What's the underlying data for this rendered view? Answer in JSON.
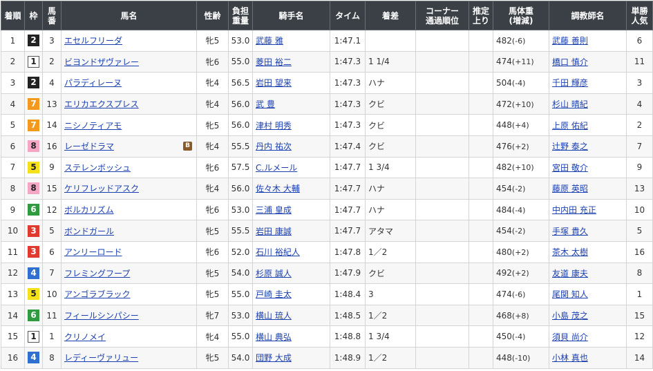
{
  "headers": {
    "rank": "着順",
    "waku": "枠",
    "umaban": [
      "馬",
      "番"
    ],
    "horse": "馬名",
    "sexage": "性齢",
    "weight": [
      "負担",
      "重量"
    ],
    "jockey": "騎手名",
    "time": "タイム",
    "margin": "着差",
    "corner": [
      "コーナー",
      "通過順位"
    ],
    "last": [
      "推定",
      "上り"
    ],
    "body": [
      "馬体重",
      "(増減)"
    ],
    "trainer": "調教師名",
    "pop": [
      "単勝",
      "人気"
    ]
  },
  "rows": [
    {
      "rank": "1",
      "waku": "2",
      "umaban": "3",
      "horse": "エセルフリーダ",
      "blinker": "",
      "sexage": "牝5",
      "weight": "53.0",
      "jockey": "武藤 雅",
      "time": "1:47.1",
      "margin": "",
      "corner": "",
      "last": "",
      "bw": "482",
      "bwd": "(-6)",
      "trainer": "武藤 善則",
      "pop": "6"
    },
    {
      "rank": "2",
      "waku": "1",
      "umaban": "2",
      "horse": "ビヨンドザヴァレー",
      "blinker": "",
      "sexage": "牝6",
      "weight": "55.0",
      "jockey": "菱田 裕二",
      "time": "1:47.3",
      "margin": "1 1/4",
      "corner": "",
      "last": "",
      "bw": "474",
      "bwd": "(+11)",
      "trainer": "橋口 慎介",
      "pop": "11"
    },
    {
      "rank": "3",
      "waku": "2",
      "umaban": "4",
      "horse": "パラディレーヌ",
      "blinker": "",
      "sexage": "牝4",
      "weight": "56.5",
      "jockey": "岩田 望来",
      "time": "1:47.3",
      "margin": "ハナ",
      "corner": "",
      "last": "",
      "bw": "504",
      "bwd": "(-4)",
      "trainer": "千田 輝彦",
      "pop": "3"
    },
    {
      "rank": "4",
      "waku": "7",
      "umaban": "13",
      "horse": "エリカエクスプレス",
      "blinker": "",
      "sexage": "牝4",
      "weight": "56.0",
      "jockey": "武 豊",
      "time": "1:47.3",
      "margin": "クビ",
      "corner": "",
      "last": "",
      "bw": "472",
      "bwd": "(+10)",
      "trainer": "杉山 晴紀",
      "pop": "4"
    },
    {
      "rank": "5",
      "waku": "7",
      "umaban": "14",
      "horse": "ニシノティアモ",
      "blinker": "",
      "sexage": "牝5",
      "weight": "56.0",
      "jockey": "津村 明秀",
      "time": "1:47.3",
      "margin": "クビ",
      "corner": "",
      "last": "",
      "bw": "448",
      "bwd": "(+4)",
      "trainer": "上原 佑紀",
      "pop": "2"
    },
    {
      "rank": "6",
      "waku": "8",
      "umaban": "16",
      "horse": "レーゼドラマ",
      "blinker": "B",
      "sexage": "牝4",
      "weight": "55.5",
      "jockey": "丹内 祐次",
      "time": "1:47.4",
      "margin": "クビ",
      "corner": "",
      "last": "",
      "bw": "476",
      "bwd": "(+2)",
      "trainer": "辻野 泰之",
      "pop": "7"
    },
    {
      "rank": "7",
      "waku": "5",
      "umaban": "9",
      "horse": "ステレンボッシュ",
      "blinker": "",
      "sexage": "牝6",
      "weight": "57.5",
      "jockey": "C.ルメール",
      "time": "1:47.7",
      "margin": "1 3/4",
      "corner": "",
      "last": "",
      "bw": "482",
      "bwd": "(+10)",
      "trainer": "宮田 敬介",
      "pop": "9"
    },
    {
      "rank": "8",
      "waku": "8",
      "umaban": "15",
      "horse": "ケリフレッドアスク",
      "blinker": "",
      "sexage": "牝4",
      "weight": "56.0",
      "jockey": "佐々木 大輔",
      "time": "1:47.7",
      "margin": "ハナ",
      "corner": "",
      "last": "",
      "bw": "454",
      "bwd": "(-2)",
      "trainer": "藤原 英昭",
      "pop": "13"
    },
    {
      "rank": "9",
      "waku": "6",
      "umaban": "12",
      "horse": "ボルカリズム",
      "blinker": "",
      "sexage": "牝6",
      "weight": "53.0",
      "jockey": "三浦 皇成",
      "time": "1:47.7",
      "margin": "ハナ",
      "corner": "",
      "last": "",
      "bw": "484",
      "bwd": "(-4)",
      "trainer": "中内田 充正",
      "pop": "10"
    },
    {
      "rank": "10",
      "waku": "3",
      "umaban": "5",
      "horse": "ボンドガール",
      "blinker": "",
      "sexage": "牝5",
      "weight": "55.5",
      "jockey": "岩田 康誠",
      "time": "1:47.7",
      "margin": "アタマ",
      "corner": "",
      "last": "",
      "bw": "454",
      "bwd": "(-2)",
      "trainer": "手塚 貴久",
      "pop": "5"
    },
    {
      "rank": "11",
      "waku": "3",
      "umaban": "6",
      "horse": "アンリーロード",
      "blinker": "",
      "sexage": "牝6",
      "weight": "52.0",
      "jockey": "石川 裕紀人",
      "time": "1:47.8",
      "margin": "1／2",
      "corner": "",
      "last": "",
      "bw": "480",
      "bwd": "(+2)",
      "trainer": "茶木 太樹",
      "pop": "16"
    },
    {
      "rank": "12",
      "waku": "4",
      "umaban": "7",
      "horse": "フレミングフープ",
      "blinker": "",
      "sexage": "牝5",
      "weight": "54.0",
      "jockey": "杉原 誠人",
      "time": "1:47.9",
      "margin": "クビ",
      "corner": "",
      "last": "",
      "bw": "492",
      "bwd": "(+2)",
      "trainer": "友道 康夫",
      "pop": "8"
    },
    {
      "rank": "13",
      "waku": "5",
      "umaban": "10",
      "horse": "アンゴラブラック",
      "blinker": "",
      "sexage": "牝5",
      "weight": "55.0",
      "jockey": "戸崎 圭太",
      "time": "1:48.4",
      "margin": "3",
      "corner": "",
      "last": "",
      "bw": "474",
      "bwd": "(-6)",
      "trainer": "尾関 知人",
      "pop": "1"
    },
    {
      "rank": "14",
      "waku": "6",
      "umaban": "11",
      "horse": "フィールシンパシー",
      "blinker": "",
      "sexage": "牝7",
      "weight": "53.0",
      "jockey": "横山 琉人",
      "time": "1:48.5",
      "margin": "1／2",
      "corner": "",
      "last": "",
      "bw": "468",
      "bwd": "(+8)",
      "trainer": "小島 茂之",
      "pop": "15"
    },
    {
      "rank": "15",
      "waku": "1",
      "umaban": "1",
      "horse": "クリノメイ",
      "blinker": "",
      "sexage": "牝4",
      "weight": "55.0",
      "jockey": "横山 典弘",
      "time": "1:48.8",
      "margin": "1 3/4",
      "corner": "",
      "last": "",
      "bw": "450",
      "bwd": "(-4)",
      "trainer": "須貝 尚介",
      "pop": "12"
    },
    {
      "rank": "16",
      "waku": "4",
      "umaban": "8",
      "horse": "レディーヴァリュー",
      "blinker": "",
      "sexage": "牝5",
      "weight": "54.0",
      "jockey": "団野 大成",
      "time": "1:48.9",
      "margin": "1／2",
      "corner": "",
      "last": "",
      "bw": "448",
      "bwd": "(-10)",
      "trainer": "小林 真也",
      "pop": "14"
    }
  ]
}
